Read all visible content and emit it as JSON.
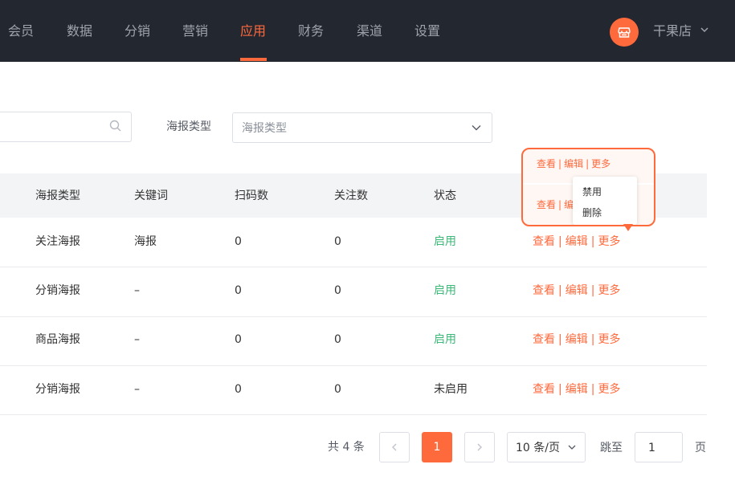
{
  "nav": {
    "items": [
      {
        "label": "会员"
      },
      {
        "label": "数据"
      },
      {
        "label": "分销"
      },
      {
        "label": "营销"
      },
      {
        "label": "应用"
      },
      {
        "label": "财务"
      },
      {
        "label": "渠道"
      },
      {
        "label": "设置"
      }
    ],
    "active": "应用",
    "store_name": "干果店",
    "store_icon": "store-icon"
  },
  "filter": {
    "search_value": "",
    "type_label": "海报类型",
    "type_placeholder": "海报类型"
  },
  "table": {
    "columns": [
      "海报类型",
      "关键词",
      "扫码数",
      "关注数",
      "状态"
    ],
    "rows": [
      {
        "type": "关注海报",
        "keyword": "海报",
        "scans": "0",
        "follows": "0",
        "status": "启用"
      },
      {
        "type": "分销海报",
        "keyword": "–",
        "scans": "0",
        "follows": "0",
        "status": "启用"
      },
      {
        "type": "商品海报",
        "keyword": "–",
        "scans": "0",
        "follows": "0",
        "status": "启用"
      },
      {
        "type": "分销海报",
        "keyword": "–",
        "scans": "0",
        "follows": "0",
        "status": "未启用"
      }
    ],
    "actions": {
      "view": "查看",
      "edit": "编辑",
      "more": "更多",
      "sep": "|"
    }
  },
  "more_menu": {
    "items": [
      "禁用",
      "删除"
    ],
    "peek_view": "查看",
    "peek_edit": "编"
  },
  "pagination": {
    "total": "共 4 条",
    "current_page": "1",
    "page_size": "10 条/页",
    "jump_label": "跳至",
    "jump_value": "1",
    "page_suffix": "页"
  },
  "colors": {
    "topbar": "#232730",
    "accent": "#ff6a3d",
    "status_on": "#3cb878"
  }
}
